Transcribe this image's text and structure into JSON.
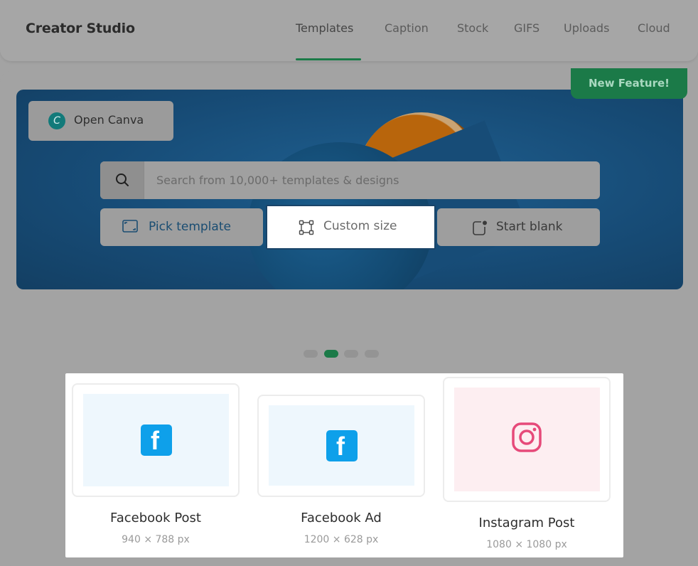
{
  "header": {
    "brand": "Creator Studio",
    "tabs": [
      {
        "label": "Templates",
        "active": true
      },
      {
        "label": "Caption",
        "active": false
      },
      {
        "label": "Stock",
        "active": false
      },
      {
        "label": "GIFS",
        "active": false
      },
      {
        "label": "Uploads",
        "active": false
      },
      {
        "label": "Cloud",
        "active": false
      }
    ]
  },
  "hero": {
    "open_canva_label": "Open Canva",
    "canva_logo_letter": "C",
    "new_feature_badge": "New Feature!",
    "search_placeholder": "Search from 10,000+ templates & designs",
    "actions": {
      "pick_template": "Pick template",
      "custom_size": "Custom size",
      "start_blank": "Start blank"
    }
  },
  "carousel": {
    "total": 4,
    "active_index": 1
  },
  "templates": [
    {
      "title": "Facebook Post",
      "size": "940 × 788 px",
      "icon": "facebook-icon"
    },
    {
      "title": "Facebook Ad",
      "size": "1200 × 628 px",
      "icon": "facebook-icon"
    },
    {
      "title": "Instagram Post",
      "size": "1080 × 1080 px",
      "icon": "instagram-icon"
    }
  ],
  "colors": {
    "accent_green": "#1b7a48",
    "facebook_blue": "#0ea0ea",
    "instagram_pink": "#e64a7a"
  }
}
